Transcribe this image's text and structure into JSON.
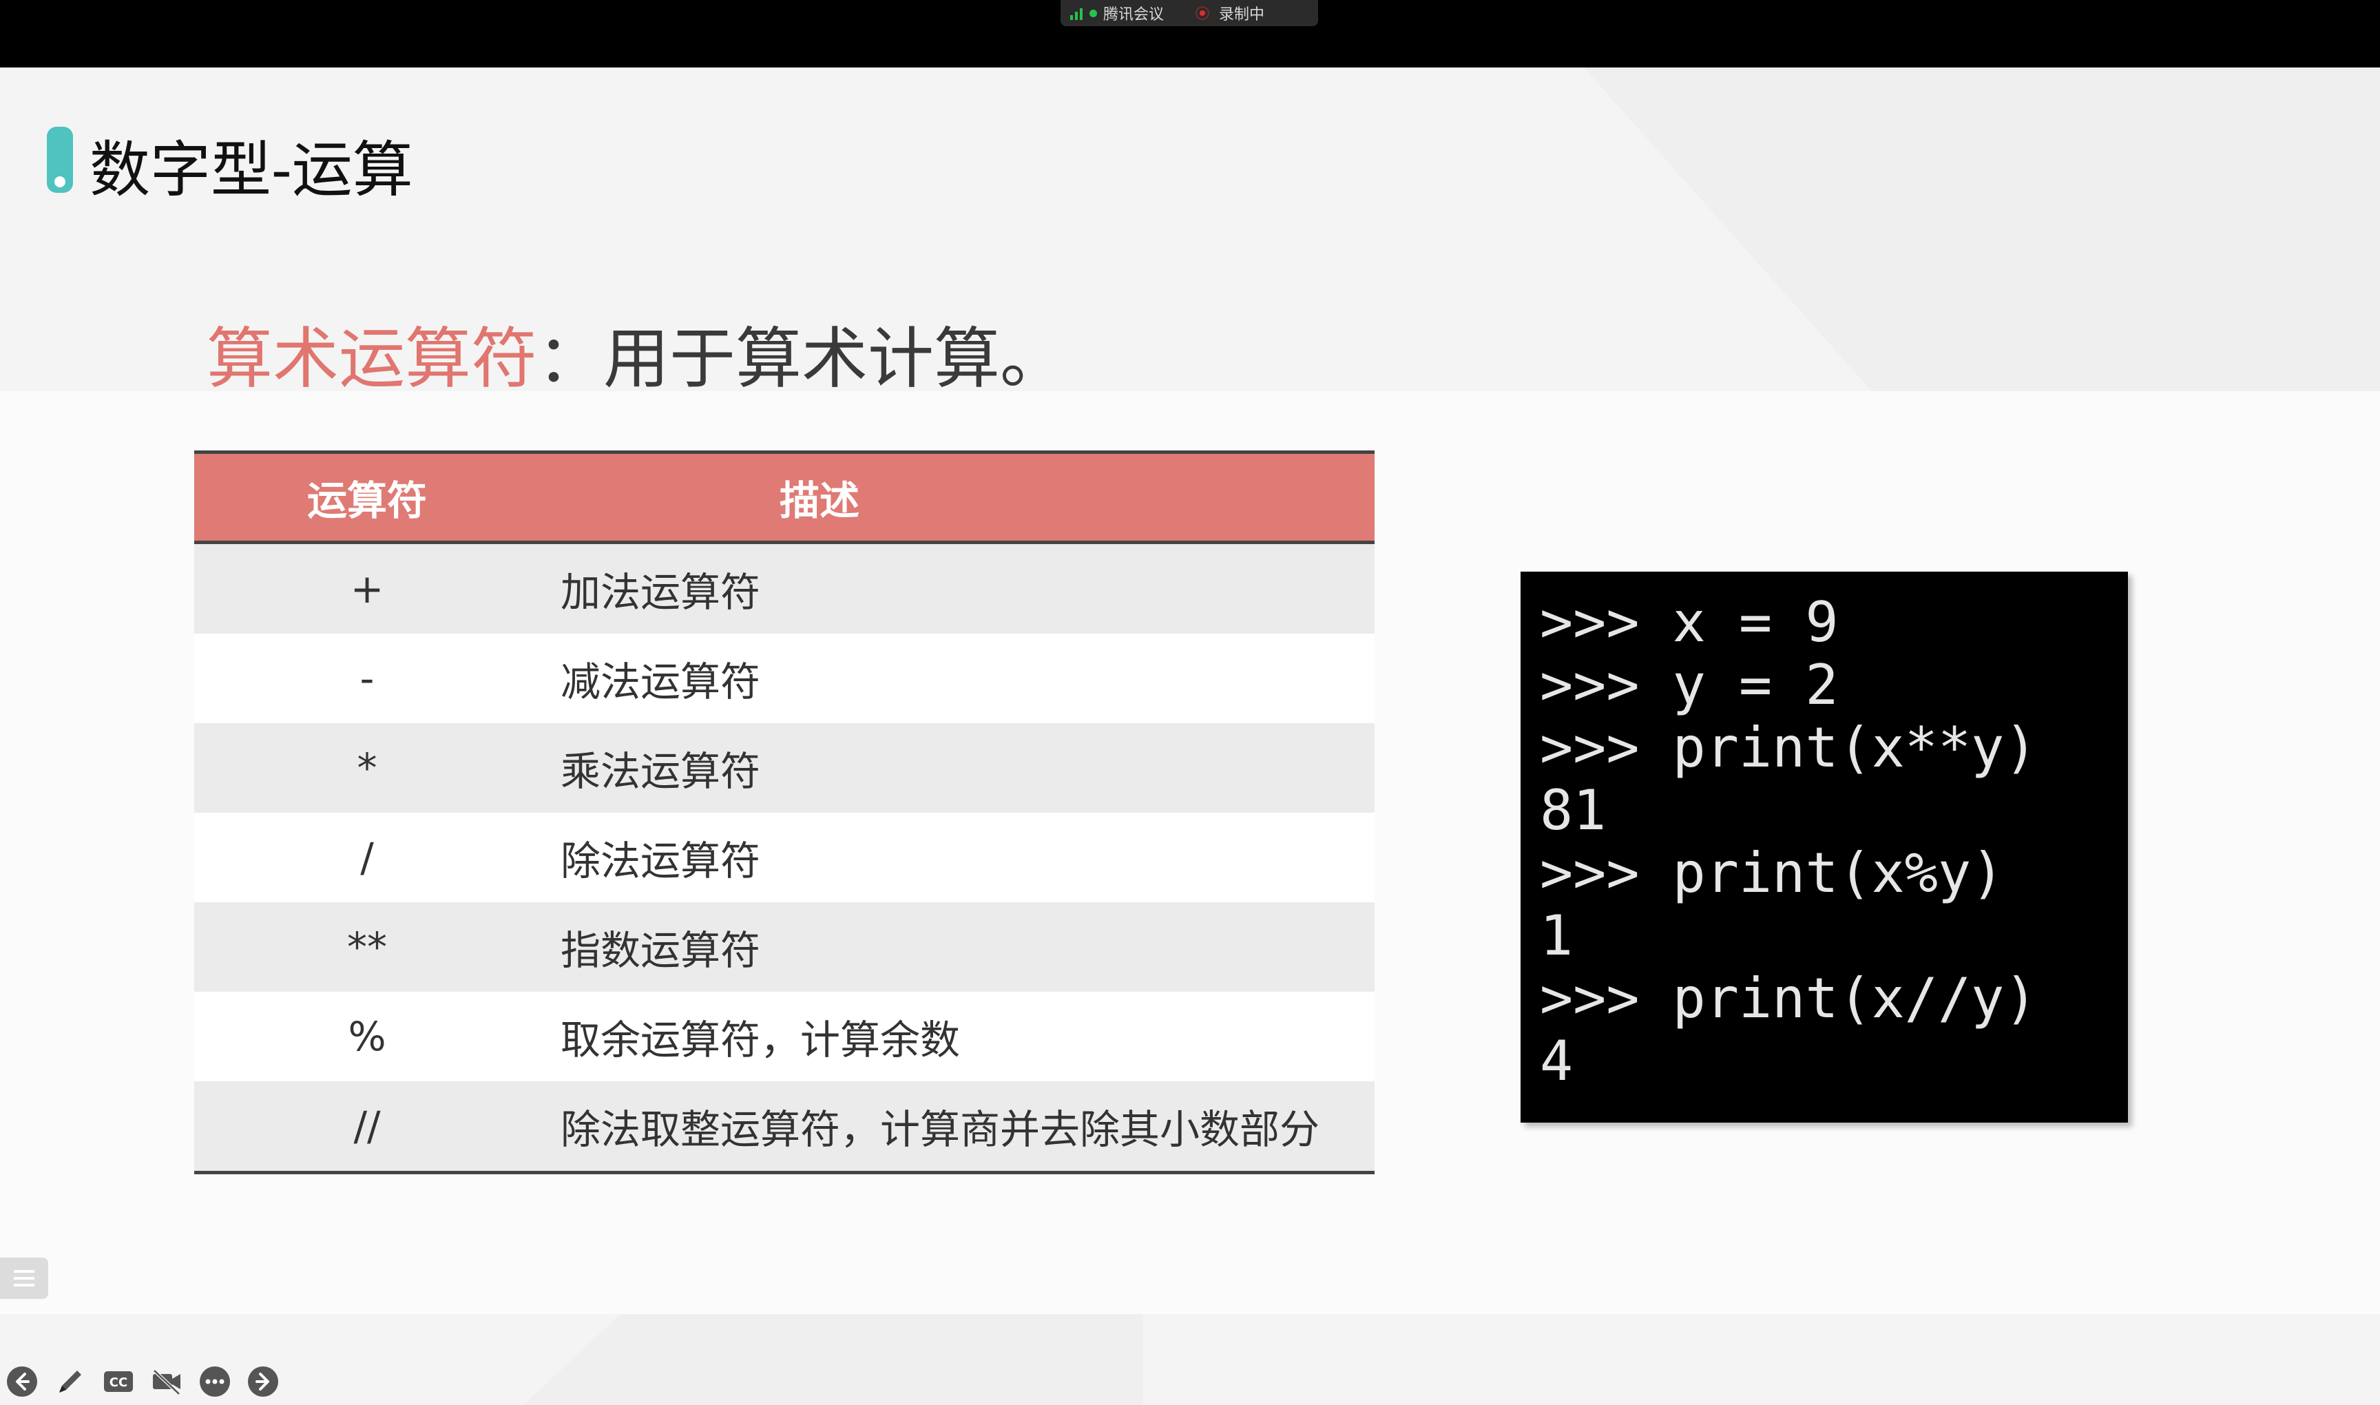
{
  "meeting": {
    "app_name": "腾讯会议",
    "recording_label": "录制中"
  },
  "slide": {
    "title": "数字型-运算",
    "subtitle_accent": "算术运算符",
    "subtitle_rest": "：用于算术计算。"
  },
  "table": {
    "headers": [
      "运算符",
      "描述"
    ],
    "rows": [
      {
        "op": "+",
        "desc": "加法运算符"
      },
      {
        "op": "-",
        "desc": "减法运算符"
      },
      {
        "op": "*",
        "desc": "乘法运算符"
      },
      {
        "op": "/",
        "desc": "除法运算符"
      },
      {
        "op": "**",
        "desc": "指数运算符"
      },
      {
        "op": "%",
        "desc": "取余运算符，计算余数"
      },
      {
        "op": "//",
        "desc": "除法取整运算符，计算商并去除其小数部分"
      }
    ]
  },
  "console": {
    "lines": [
      ">>> x = 9",
      ">>> y = 2",
      ">>> print(x**y)",
      "81",
      ">>> print(x%y)",
      "1",
      ">>> print(x//y)",
      "4"
    ]
  },
  "toolbar": {
    "icons": [
      "arrow-left-icon",
      "pen-icon",
      "captions-icon",
      "video-off-icon",
      "more-icon",
      "arrow-right-icon"
    ]
  },
  "colors": {
    "accent": "#e0766f",
    "table_header": "#df7a75",
    "title_marker": "#4ec3c0",
    "console_bg": "#000000"
  }
}
